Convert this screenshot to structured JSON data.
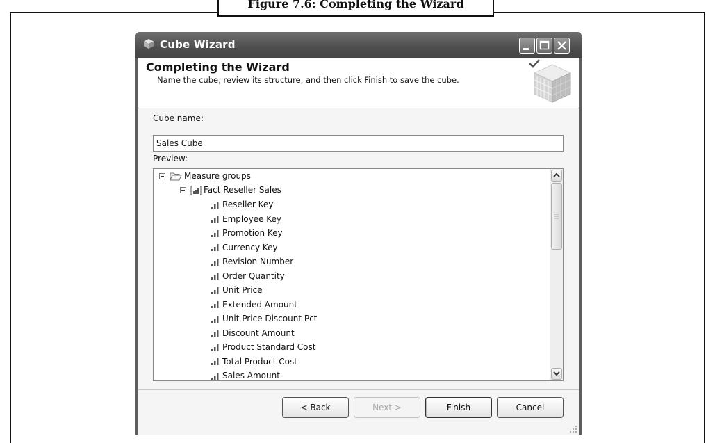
{
  "figure": {
    "caption": "Figure 7.6: Completing the Wizard"
  },
  "window": {
    "title": "Cube Wizard"
  },
  "header": {
    "title": "Completing the Wizard",
    "subtitle": "Name the cube, review its structure, and then click Finish to save the cube."
  },
  "form": {
    "cube_name_label": "Cube name:",
    "cube_name_value": "Sales Cube",
    "preview_label": "Preview:"
  },
  "tree": {
    "root": {
      "label": "Measure groups",
      "icon": "folder-open-icon"
    },
    "group": {
      "label": "Fact Reseller Sales",
      "icon": "measure-group-icon"
    },
    "measures": [
      "Reseller Key",
      "Employee Key",
      "Promotion Key",
      "Currency Key",
      "Revision Number",
      "Order Quantity",
      "Unit Price",
      "Extended Amount",
      "Unit Price Discount Pct",
      "Discount Amount",
      "Product Standard Cost",
      "Total Product Cost",
      "Sales Amount"
    ]
  },
  "buttons": {
    "back": "< Back",
    "next": "Next >",
    "finish": "Finish",
    "cancel": "Cancel"
  }
}
